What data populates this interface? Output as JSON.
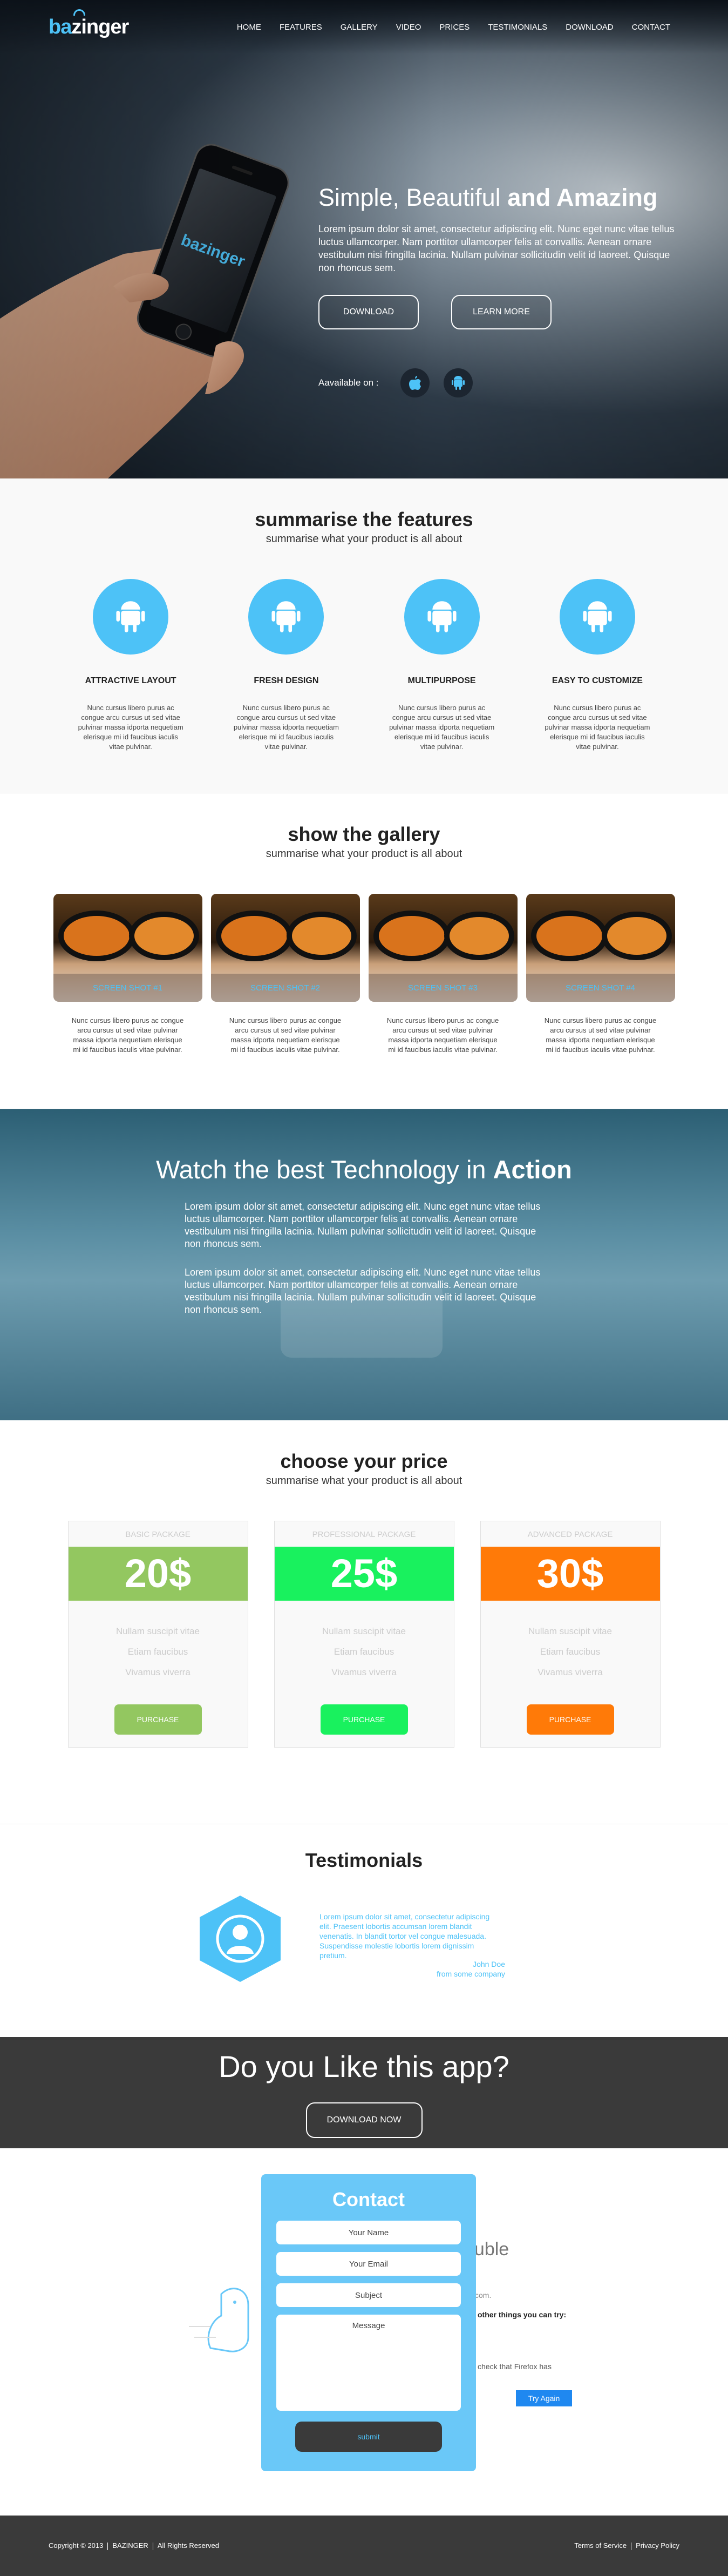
{
  "brand": {
    "name_pre": "ba",
    "name_post": "zinger",
    "phone_logo": "bazinger"
  },
  "nav": [
    "HOME",
    "FEATURES",
    "GALLERY",
    "VIDEO",
    "PRICES",
    "TESTIMONIALS",
    "DOWNLOAD",
    "CONTACT"
  ],
  "hero": {
    "title_plain": "Simple, Beautiful ",
    "title_bold": "and Amazing",
    "body": "Lorem ipsum dolor sit amet, consectetur adipiscing elit. Nunc eget nunc vitae tellus luctus ullamcorper. Nam porttitor ullamcorper felis at convallis. Aenean ornare vestibulum nisi fringilla lacinia. Nullam pulvinar sollicitudin velit id laoreet. Quisque non rhoncus sem.",
    "download": "DOWNLOAD",
    "learn_more": "LEARN MORE",
    "available": "Aavailable on :",
    "icons": [
      "apple-icon",
      "android-icon"
    ]
  },
  "features": {
    "title": "summarise the features",
    "subtitle": "summarise what your product is all about",
    "items": [
      {
        "title": "ATTRACTIVE LAYOUT",
        "text": "Nunc cursus libero purus ac congue arcu cursus ut sed vitae pulvinar massa idporta nequetiam elerisque mi id faucibus iaculis vitae pulvinar."
      },
      {
        "title": "FRESH DESIGN",
        "text": "Nunc cursus libero purus ac congue arcu cursus ut sed vitae pulvinar massa idporta nequetiam elerisque mi id faucibus iaculis vitae pulvinar."
      },
      {
        "title": "MULTIPURPOSE",
        "text": "Nunc cursus libero purus ac congue arcu cursus ut sed vitae pulvinar massa idporta nequetiam elerisque mi id faucibus iaculis vitae pulvinar."
      },
      {
        "title": "EASY TO CUSTOMIZE",
        "text": "Nunc cursus libero purus ac congue arcu cursus ut sed vitae pulvinar massa idporta nequetiam elerisque mi id faucibus iaculis vitae pulvinar."
      }
    ]
  },
  "gallery": {
    "title": "show the gallery",
    "subtitle": "summarise what your product is all about",
    "items": [
      {
        "label": "SCREEN SHOT #1",
        "text": "Nunc cursus libero purus ac congue arcu cursus ut sed vitae pulvinar massa idporta nequetiam elerisque mi id faucibus iaculis vitae pulvinar."
      },
      {
        "label": "SCREEN SHOT #2",
        "text": "Nunc cursus libero purus ac congue arcu cursus ut sed vitae pulvinar massa idporta nequetiam elerisque mi id faucibus iaculis vitae pulvinar."
      },
      {
        "label": "SCREEN SHOT #3",
        "text": "Nunc cursus libero purus ac congue arcu cursus ut sed vitae pulvinar massa idporta nequetiam elerisque mi id faucibus iaculis vitae pulvinar."
      },
      {
        "label": "SCREEN SHOT #4",
        "text": "Nunc cursus libero purus ac congue arcu cursus ut sed vitae pulvinar massa idporta nequetiam elerisque mi id faucibus iaculis vitae pulvinar."
      }
    ]
  },
  "action": {
    "title_plain": "Watch the best Technology in ",
    "title_bold": "Action",
    "para1": "Lorem ipsum dolor sit amet, consectetur adipiscing elit. Nunc eget nunc vitae tellus luctus ullamcorper. Nam porttitor ullamcorper felis at convallis. Aenean ornare vestibulum nisi fringilla lacinia. Nullam pulvinar sollicitudin velit id laoreet. Quisque non rhoncus sem.",
    "para2": "Lorem ipsum dolor sit amet, consectetur adipiscing elit. Nunc eget nunc vitae tellus luctus ullamcorper. Nam porttitor ullamcorper felis at convallis. Aenean ornare vestibulum nisi fringilla lacinia. Nullam pulvinar sollicitudin velit id laoreet. Quisque non rhoncus sem."
  },
  "pricing": {
    "title": "choose your price",
    "subtitle": "summarise what your product is all about",
    "plans": [
      {
        "name": "BASIC PACKAGE",
        "price": "20$",
        "color": "#93c760",
        "features": [
          "Nullam suscipit vitae",
          "Etiam faucibus",
          "Vivamus viverra"
        ],
        "button": "PURCHASE"
      },
      {
        "name": "PROFESSIONAL PACKAGE",
        "price": "25$",
        "color": "#19f15e",
        "features": [
          "Nullam suscipit vitae",
          "Etiam faucibus",
          "Vivamus viverra"
        ],
        "button": "PURCHASE"
      },
      {
        "name": "ADVANCED PACKAGE",
        "price": "30$",
        "color": "#ff7a08",
        "features": [
          "Nullam suscipit vitae",
          "Etiam faucibus",
          "Vivamus viverra"
        ],
        "button": "PURCHASE"
      }
    ]
  },
  "testimonials": {
    "title": "Testimonials",
    "quote": "Lorem ipsum dolor sit amet, consectetur adipiscing elit. Praesent lobortis accumsan lorem blandit venenatis. In blandit tortor vel congue malesuada. Suspendisse molestie lobortis lorem dignissim pretium.",
    "author": "John Doe",
    "author_from": "from some company"
  },
  "cta": {
    "title": "Do you Like this app?",
    "button": "DOWNLOAD NOW"
  },
  "contact": {
    "title": "Contact",
    "name_ph": "Your Name",
    "email_ph": "Your Email",
    "subject_ph": "Subject",
    "message_ph": "Message",
    "submit": "submit",
    "bg_title_frag": "ouble",
    "bg_line1": "com.",
    "bg_line2": "other things you can try:",
    "bg_line3": "check that Firefox has",
    "try_again": "Try Again"
  },
  "footer": {
    "copyright": "Copyright © 2013",
    "brand": "BAZINGER",
    "rights": "All Rights Reserved",
    "terms": "Terms of Service",
    "privacy": "Privacy Policy"
  },
  "colors": {
    "accent": "#4dc2f7",
    "dark": "#3a3a3a"
  }
}
